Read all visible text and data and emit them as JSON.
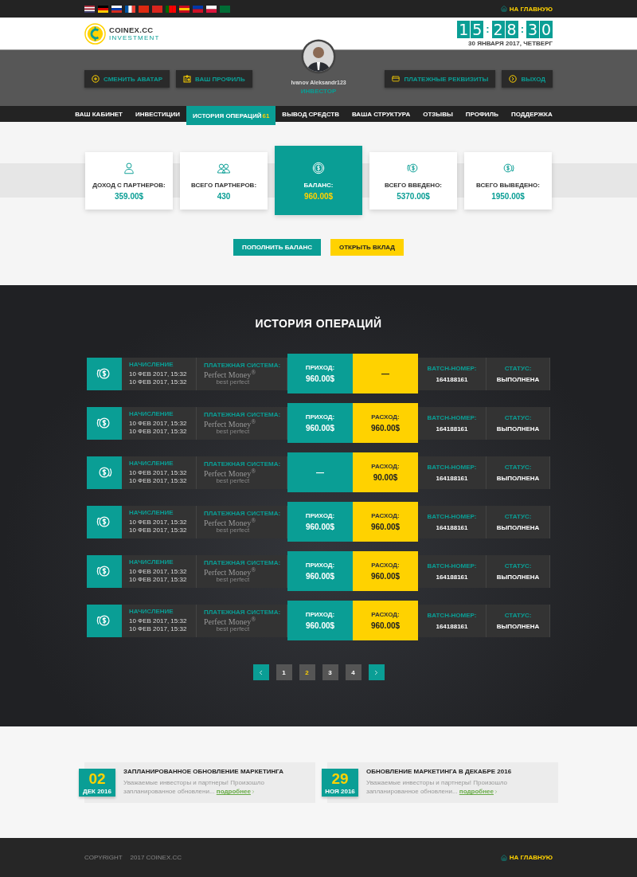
{
  "top_bar": {
    "home_link": "НА ГЛАВНУЮ"
  },
  "header": {
    "logo": {
      "name": "COINEX.CC",
      "tagline": "INVESTMENT"
    },
    "clock": {
      "groups": [
        "15",
        "28",
        "30"
      ],
      "separators": [
        ":",
        ":"
      ]
    },
    "date": "30 ЯНВАРЯ 2017, ЧЕТВЕРГ"
  },
  "profile": {
    "name": "Ivanov Aleksandr123",
    "role": "ИНВЕСТОР",
    "left_buttons": [
      {
        "kind": "avatar",
        "label": "СМЕНИТЬ АВАТАР"
      },
      {
        "kind": "profile",
        "label": "ВАШ ПРОФИЛЬ"
      }
    ],
    "right_buttons": [
      {
        "kind": "card",
        "label": "ПЛАТЕЖНЫЕ РЕКВИЗИТЫ"
      },
      {
        "kind": "exit",
        "label": "ВЫХОД"
      }
    ]
  },
  "nav": [
    {
      "label": "ВАШ КАБИНЕТ",
      "selected": false
    },
    {
      "label": "ИНВЕСТИЦИИ",
      "selected": false
    },
    {
      "label": "ИСТОРИЯ ОПЕРАЦИЙ",
      "badge": "61",
      "selected": true
    },
    {
      "label": "ВЫВОД СРЕДСТВ",
      "selected": false
    },
    {
      "label": "ВАША СТРУКТУРА",
      "selected": false
    },
    {
      "label": "ОТЗЫВЫ",
      "selected": false
    },
    {
      "label": "ПРОФИЛЬ",
      "selected": false
    },
    {
      "label": "ПОДДЕРЖКА",
      "selected": false
    }
  ],
  "stats": [
    {
      "kind": "user",
      "label": "ДОХОД С ПАРТНЕРОВ:",
      "value": "359.00$",
      "selected": false
    },
    {
      "kind": "users",
      "label": "ВСЕГО ПАРТНЕРОВ:",
      "value": "430",
      "selected": false
    },
    {
      "kind": "coin",
      "label": "БАЛАНС:",
      "value": "960.00$",
      "selected": true
    },
    {
      "kind": "coin_in",
      "label": "ВСЕГО ВВЕДЕНО:",
      "value": "5370.00$",
      "selected": false
    },
    {
      "kind": "coin_out",
      "label": "ВСЕГО ВЫВЕДЕНО:",
      "value": "1950.00$",
      "selected": false
    }
  ],
  "actions": [
    {
      "kind": "primary",
      "label": "ПОПОЛНИТЬ БАЛАНС"
    },
    {
      "kind": "accent",
      "label": "ОТКРЫТЬ ВКЛАД"
    }
  ],
  "history": {
    "title": "ИСТОРИЯ ОПЕРАЦИЙ",
    "rows": [
      {
        "kind": "in",
        "date_label": "НАЧИСЛЕНИЕ",
        "dates": [
          "10 ФЕВ 2017, 15:32",
          "10 ФЕВ 2017, 15:32"
        ],
        "system_label": "ПЛАТЕЖНАЯ СИСТЕМА:",
        "system": "Perfect Money",
        "system_mark": "®",
        "system_tagline": "best perfect",
        "income": {
          "label": "ПРИХОД:",
          "value": "960.00$"
        },
        "expense": {
          "value": "—"
        },
        "batch_label": "BATCH-НОМЕР:",
        "batch": "164188161",
        "status_label": "СТАТУС:",
        "status": "ВЫПОЛНЕНА"
      },
      {
        "kind": "in",
        "date_label": "НАЧИСЛЕНИЕ",
        "dates": [
          "10 ФЕВ 2017, 15:32",
          "10 ФЕВ 2017, 15:32"
        ],
        "system_label": "ПЛАТЕЖНАЯ СИСТЕМА:",
        "system": "Perfect Money",
        "system_mark": "®",
        "system_tagline": "best perfect",
        "income": {
          "label": "ПРИХОД:",
          "value": "960.00$"
        },
        "expense": {
          "label": "РАСХОД:",
          "value": "960.00$"
        },
        "batch_label": "BATCH-НОМЕР:",
        "batch": "164188161",
        "status_label": "СТАТУС:",
        "status": "ВЫПОЛНЕНА"
      },
      {
        "kind": "out",
        "date_label": "НАЧИСЛЕНИЕ",
        "dates": [
          "10 ФЕВ 2017, 15:32",
          "10 ФЕВ 2017, 15:32"
        ],
        "system_label": "ПЛАТЕЖНАЯ СИСТЕМА:",
        "system": "Perfect Money",
        "system_mark": "®",
        "system_tagline": "best perfect",
        "income": {
          "value": "—"
        },
        "expense": {
          "label": "РАСХОД:",
          "value": "90.00$"
        },
        "batch_label": "BATCH-НОМЕР:",
        "batch": "164188161",
        "status_label": "СТАТУС:",
        "status": "ВЫПОЛНЕНА"
      },
      {
        "kind": "in",
        "date_label": "НАЧИСЛЕНИЕ",
        "dates": [
          "10 ФЕВ 2017, 15:32",
          "10 ФЕВ 2017, 15:32"
        ],
        "system_label": "ПЛАТЕЖНАЯ СИСТЕМА:",
        "system": "Perfect Money",
        "system_mark": "®",
        "system_tagline": "best perfect",
        "income": {
          "label": "ПРИХОД:",
          "value": "960.00$"
        },
        "expense": {
          "label": "РАСХОД:",
          "value": "960.00$"
        },
        "batch_label": "BATCH-НОМЕР:",
        "batch": "164188161",
        "status_label": "СТАТУС:",
        "status": "ВЫПОЛНЕНА"
      },
      {
        "kind": "in",
        "date_label": "НАЧИСЛЕНИЕ",
        "dates": [
          "10 ФЕВ 2017, 15:32",
          "10 ФЕВ 2017, 15:32"
        ],
        "system_label": "ПЛАТЕЖНАЯ СИСТЕМА:",
        "system": "Perfect Money",
        "system_mark": "®",
        "system_tagline": "best perfect",
        "income": {
          "label": "ПРИХОД:",
          "value": "960.00$"
        },
        "expense": {
          "label": "РАСХОД:",
          "value": "960.00$"
        },
        "batch_label": "BATCH-НОМЕР:",
        "batch": "164188161",
        "status_label": "СТАТУС:",
        "status": "ВЫПОЛНЕНА"
      },
      {
        "kind": "in",
        "date_label": "НАЧИСЛЕНИЕ",
        "dates": [
          "10 ФЕВ 2017, 15:32",
          "10 ФЕВ 2017, 15:32"
        ],
        "system_label": "ПЛАТЕЖНАЯ СИСТЕМА:",
        "system": "Perfect Money",
        "system_mark": "®",
        "system_tagline": "best perfect",
        "income": {
          "label": "ПРИХОД:",
          "value": "960.00$"
        },
        "expense": {
          "label": "РАСХОД:",
          "value": "960.00$"
        },
        "batch_label": "BATCH-НОМЕР:",
        "batch": "164188161",
        "status_label": "СТАТУС:",
        "status": "ВЫПОЛНЕНА"
      }
    ]
  },
  "pagination": [
    {
      "label": "1",
      "selected": false
    },
    {
      "label": "2",
      "selected": true
    },
    {
      "label": "3",
      "selected": false
    },
    {
      "label": "4",
      "selected": false
    }
  ],
  "news": [
    {
      "day": "02",
      "month": "ДЕК 2016",
      "title": "ЗАПЛАНИРОВАННОЕ ОБНОВЛЕНИЕ МАРКЕТИНГА",
      "text": "Уважаемые инвесторы и партнеры! Произошло запланированное обновлени...",
      "link": "подробнее"
    },
    {
      "day": "29",
      "month": "НОЯ 2016",
      "title": "ОБНОВЛЕНИЕ МАРКЕТИНГА В ДЕКАБРЕ 2016",
      "text": "Уважаемые инвесторы и партнеры! Произошло запланированное обновлени...",
      "link": "подробнее"
    }
  ],
  "footer": {
    "copyright": "COPYRIGHT",
    "year": "2017 COINEX.CC",
    "home_link": "НА ГЛАВНУЮ"
  }
}
